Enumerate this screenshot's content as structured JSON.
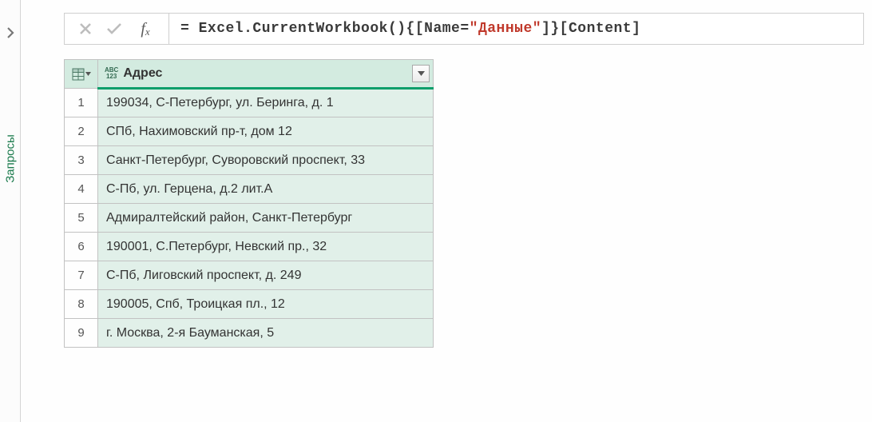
{
  "sidebar": {
    "label": "Запросы"
  },
  "formula": {
    "prefix": "= Excel.CurrentWorkbook(){[Name=",
    "string": "\"Данные\"",
    "suffix": "]}[Content]"
  },
  "table": {
    "column_header": "Адрес",
    "type_abc": "ABC",
    "type_123": "123",
    "rows": [
      "199034, С-Петербург, ул. Беринга, д. 1",
      "СПб, Нахимовский пр-т, дом 12",
      "Санкт-Петербург, Суворовский проспект, 33",
      "С-Пб, ул. Герцена, д.2 лит.А",
      "Адмиралтейский район, Санкт-Петербург",
      "190001, С.Петербург, Невский пр., 32",
      "С-Пб, Лиговский проспект, д. 249",
      "190005, Спб, Троицкая пл., 12",
      "г. Москва, 2-я Бауманская, 5"
    ]
  }
}
